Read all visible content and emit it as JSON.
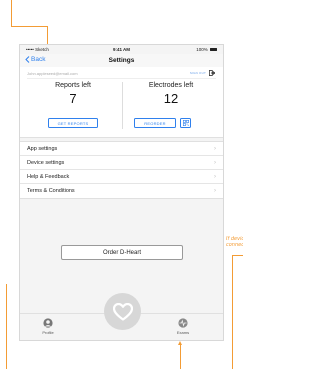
{
  "annotations": {
    "color": "#f39c35",
    "side_note": "If device\nconnect"
  },
  "status_bar": {
    "carrier": "••••• Sketch",
    "time": "9:41 AM",
    "battery": "100%"
  },
  "nav": {
    "back_label": "Back",
    "title": "Settings"
  },
  "account": {
    "email": "John.appleseed@email.com",
    "signout_label": "SIGN OUT"
  },
  "reports": {
    "label": "Reports left",
    "value": "7",
    "button": "GET REPORTS"
  },
  "electrodes": {
    "label": "Electrodes left",
    "value": "12",
    "button": "REORDER"
  },
  "settings_list": [
    {
      "label": "App settings"
    },
    {
      "label": "Device settings"
    },
    {
      "label": "Help & Feedback"
    },
    {
      "label": "Terms & Conditions"
    }
  ],
  "order_button": "Order D-Heart",
  "tabbar": {
    "profile": "Profile",
    "exams": "Exams"
  },
  "colors": {
    "accent": "#2f80ed",
    "annotation": "#f39c35",
    "center_button": "#d7d7d7"
  },
  "icons": [
    "chevron-left-icon",
    "signout-icon",
    "qr-code-icon",
    "chevron-right-icon",
    "heart-icon",
    "profile-icon",
    "exams-icon"
  ]
}
